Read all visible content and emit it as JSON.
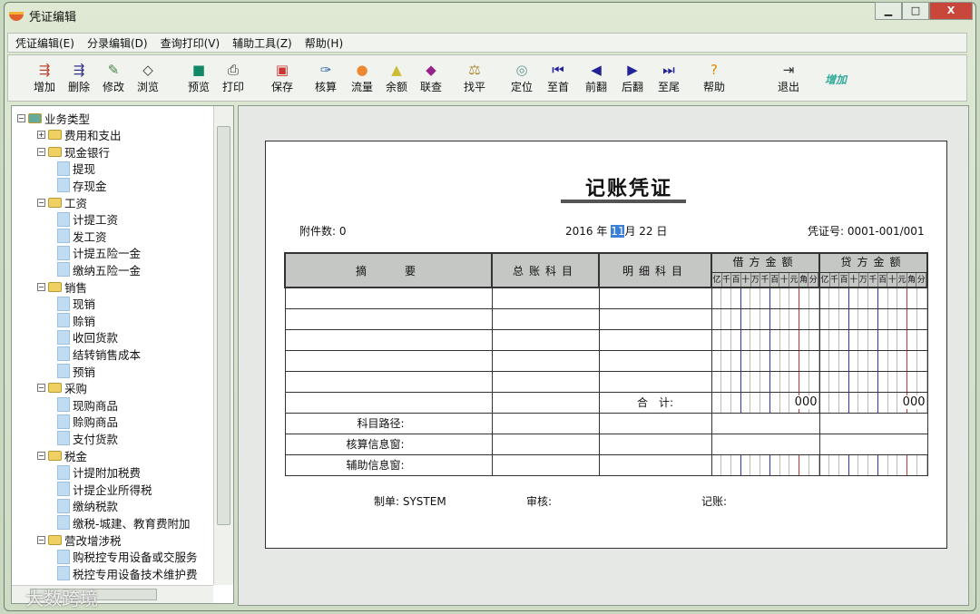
{
  "window": {
    "title": "凭证编辑",
    "controls": [
      "minimize",
      "maximize",
      "close"
    ]
  },
  "menu": [
    "凭证编辑(E)",
    "分录编辑(D)",
    "查询打印(V)",
    "辅助工具(Z)",
    "帮助(H)"
  ],
  "toolbar": [
    {
      "label": "增加",
      "icon": "add-entry-icon",
      "glyph": "⇶",
      "color": "#b43"
    },
    {
      "label": "删除",
      "icon": "delete-entry-icon",
      "glyph": "⇶",
      "color": "#338"
    },
    {
      "label": "修改",
      "icon": "edit-icon",
      "glyph": "✎",
      "color": "#484"
    },
    {
      "label": "浏览",
      "icon": "browse-icon",
      "glyph": "◇",
      "color": "#333"
    },
    {
      "label": "预览",
      "icon": "preview-icon",
      "glyph": "■",
      "color": "#186"
    },
    {
      "label": "打印",
      "icon": "printer-icon",
      "glyph": "⎙",
      "color": "#333"
    },
    {
      "label": "保存",
      "icon": "save-icon",
      "glyph": "▣",
      "color": "#c33"
    },
    {
      "label": "核算",
      "icon": "paperclip-icon",
      "glyph": "✑",
      "color": "#36a"
    },
    {
      "label": "流量",
      "icon": "flow-icon",
      "glyph": "●",
      "color": "#e83"
    },
    {
      "label": "余额",
      "icon": "balance-icon",
      "glyph": "▲",
      "color": "#cb3"
    },
    {
      "label": "联查",
      "icon": "linked-query-icon",
      "glyph": "◆",
      "color": "#928"
    },
    {
      "label": "找平",
      "icon": "scale-icon",
      "glyph": "⚖",
      "color": "#a83"
    },
    {
      "label": "定位",
      "icon": "locate-icon",
      "glyph": "◎",
      "color": "#699"
    },
    {
      "label": "至首",
      "icon": "first-icon",
      "glyph": "⏮",
      "color": "#229"
    },
    {
      "label": "前翻",
      "icon": "previous-icon",
      "glyph": "◀",
      "color": "#229"
    },
    {
      "label": "后翻",
      "icon": "next-icon",
      "glyph": "▶",
      "color": "#229"
    },
    {
      "label": "至尾",
      "icon": "last-icon",
      "glyph": "⏭",
      "color": "#229"
    },
    {
      "label": "帮助",
      "icon": "help-icon",
      "glyph": "?",
      "color": "#d80"
    },
    {
      "label": "退出",
      "icon": "exit-icon",
      "glyph": "⇥",
      "color": "#333"
    }
  ],
  "toolbar_extra": "增加",
  "tree": {
    "items": [
      {
        "label": "业务类型",
        "level": 0,
        "type": "root",
        "expanded": true
      },
      {
        "label": "费用和支出",
        "level": 1,
        "type": "folder",
        "expanded": false
      },
      {
        "label": "现金银行",
        "level": 1,
        "type": "folder",
        "expanded": true
      },
      {
        "label": "提现",
        "level": 2,
        "type": "doc"
      },
      {
        "label": "存现金",
        "level": 2,
        "type": "doc"
      },
      {
        "label": "工资",
        "level": 1,
        "type": "folder",
        "expanded": true
      },
      {
        "label": "计提工资",
        "level": 2,
        "type": "doc"
      },
      {
        "label": "发工资",
        "level": 2,
        "type": "doc"
      },
      {
        "label": "计提五险一金",
        "level": 2,
        "type": "doc"
      },
      {
        "label": "缴纳五险一金",
        "level": 2,
        "type": "doc"
      },
      {
        "label": "销售",
        "level": 1,
        "type": "folder",
        "expanded": true
      },
      {
        "label": "现销",
        "level": 2,
        "type": "doc"
      },
      {
        "label": "赊销",
        "level": 2,
        "type": "doc"
      },
      {
        "label": "收回货款",
        "level": 2,
        "type": "doc"
      },
      {
        "label": "结转销售成本",
        "level": 2,
        "type": "doc"
      },
      {
        "label": "预销",
        "level": 2,
        "type": "doc"
      },
      {
        "label": "采购",
        "level": 1,
        "type": "folder",
        "expanded": true
      },
      {
        "label": "现购商品",
        "level": 2,
        "type": "doc"
      },
      {
        "label": "赊购商品",
        "level": 2,
        "type": "doc"
      },
      {
        "label": "支付货款",
        "level": 2,
        "type": "doc"
      },
      {
        "label": "税金",
        "level": 1,
        "type": "folder",
        "expanded": true
      },
      {
        "label": "计提附加税费",
        "level": 2,
        "type": "doc"
      },
      {
        "label": "计提企业所得税",
        "level": 2,
        "type": "doc"
      },
      {
        "label": "缴纳税款",
        "level": 2,
        "type": "doc"
      },
      {
        "label": "缴税-城建、教育费附加",
        "level": 2,
        "type": "doc"
      },
      {
        "label": "营改增涉税",
        "level": 1,
        "type": "folder",
        "expanded": true
      },
      {
        "label": "购税控专用设备或交服务",
        "level": 2,
        "type": "doc"
      },
      {
        "label": "税控专用设备技术维护费",
        "level": 2,
        "type": "doc"
      }
    ]
  },
  "watermark": "大数跨境",
  "voucher": {
    "title": "记账凭证",
    "attachments": "附件数: 0",
    "date": {
      "year": "2016 年",
      "month": "11",
      "month_suffix": "月 22 日"
    },
    "number": "凭证号: 0001-001/001",
    "headers": {
      "summary": "摘　　要",
      "account": "总账科目",
      "detail": "明细科目",
      "debit": "借方金额",
      "credit": "贷方金额"
    },
    "digit_headers": [
      "亿",
      "千",
      "百",
      "十",
      "万",
      "千",
      "百",
      "十",
      "元",
      "角",
      "分"
    ],
    "total_label": "合　计:",
    "debit_total": "000",
    "credit_total": "000",
    "footer_rows": [
      "科目路径:",
      "核算信息窗:",
      "辅助信息窗:"
    ],
    "maker": "制单: SYSTEM",
    "reviewer": "审核:",
    "bookkeeper": "记账:"
  }
}
